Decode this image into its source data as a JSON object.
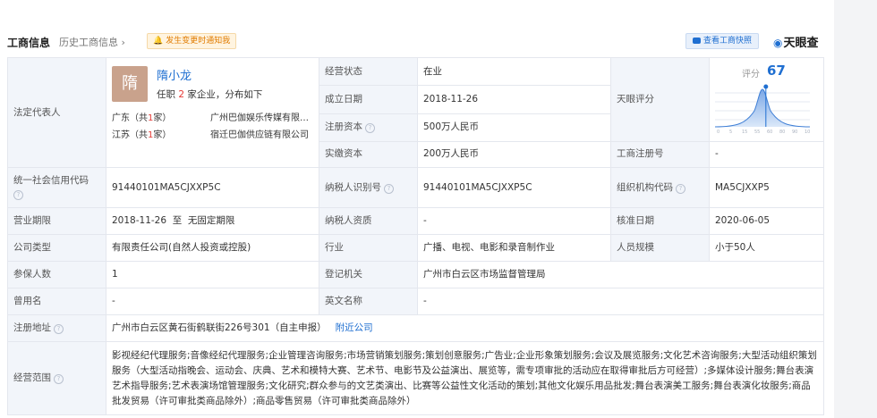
{
  "header": {
    "title": "工商信息",
    "history": "历史工商信息",
    "notify": "发生变更时通知我",
    "quick_view": "查看工商快照",
    "logo": "天眼查"
  },
  "legal_rep": {
    "label": "法定代表人",
    "avatar_char": "隋",
    "name": "隋小龙",
    "desc_prefix": "任职",
    "desc_count": "2",
    "desc_suffix": "家企业，分布如下",
    "regions": [
      {
        "region": "广东（共",
        "count": "1",
        "unit": "家）",
        "company": "广州巴伽娱乐传媒有限公司"
      },
      {
        "region": "江苏（共",
        "count": "1",
        "unit": "家）",
        "company": "宿迁巴伽供应链有限公司"
      }
    ]
  },
  "rows": {
    "status_label": "经营状态",
    "status": "在业",
    "established_label": "成立日期",
    "established": "2018-11-26",
    "reg_capital_label": "注册资本",
    "reg_capital": "500万人民币",
    "paid_capital_label": "实缴资本",
    "paid_capital": "200万人民币",
    "tianyan_label": "天眼评分",
    "reg_no_label": "工商注册号",
    "reg_no": "-",
    "credit_code_label": "统一社会信用代码",
    "credit_code": "91440101MA5CJXXP5C",
    "taxpayer_id_label": "纳税人识别号",
    "taxpayer_id": "91440101MA5CJXXP5C",
    "org_code_label": "组织机构代码",
    "org_code": "MA5CJXXP5",
    "term_label": "营业期限",
    "term": "2018-11-26  至  无固定期限",
    "taxpayer_q_label": "纳税人资质",
    "taxpayer_q": "-",
    "approval_label": "核准日期",
    "approval": "2020-06-05",
    "type_label": "公司类型",
    "type": "有限责任公司(自然人投资或控股)",
    "industry_label": "行业",
    "industry": "广播、电视、电影和录音制作业",
    "staff_label": "人员规模",
    "staff": "小于50人",
    "insured_label": "参保人数",
    "insured": "1",
    "authority_label": "登记机关",
    "authority": "广州市白云区市场监督管理局",
    "former_label": "曾用名",
    "former": "-",
    "english_label": "英文名称",
    "english": "-",
    "address_label": "注册地址",
    "address": "广州市白云区黄石街鹤联街226号301（自主申报）",
    "nearby": "附近公司",
    "scope_label": "经营范围",
    "scope": "影视经纪代理服务;音像经纪代理服务;企业管理咨询服务;市场营销策划服务;策划创意服务;广告业;企业形象策划服务;会议及展览服务;文化艺术咨询服务;大型活动组织策划服务（大型活动指晚会、运动会、庆典、艺术和模特大赛、艺术节、电影节及公益演出、展览等，需专项审批的活动应在取得审批后方可经营）;多媒体设计服务;舞台表演艺术指导服务;艺术表演场馆管理服务;文化研究;群众参与的文艺类演出、比赛等公益性文化活动的策划;其他文化娱乐用品批发;舞台表演美工服务;舞台表演化妆服务;商品批发贸易（许可审批类商品除外）;商品零售贸易（许可审批类商品除外）"
  },
  "score": {
    "label": "评分",
    "value": 67,
    "axis_ticks": [
      "0",
      "5",
      "15",
      "55",
      "60",
      "80",
      "90",
      "100"
    ]
  },
  "colors": {
    "accent": "#1f6fd1",
    "label_bg": "#f2f5fa",
    "border": "#e4e7ee",
    "red": "#e53935"
  }
}
